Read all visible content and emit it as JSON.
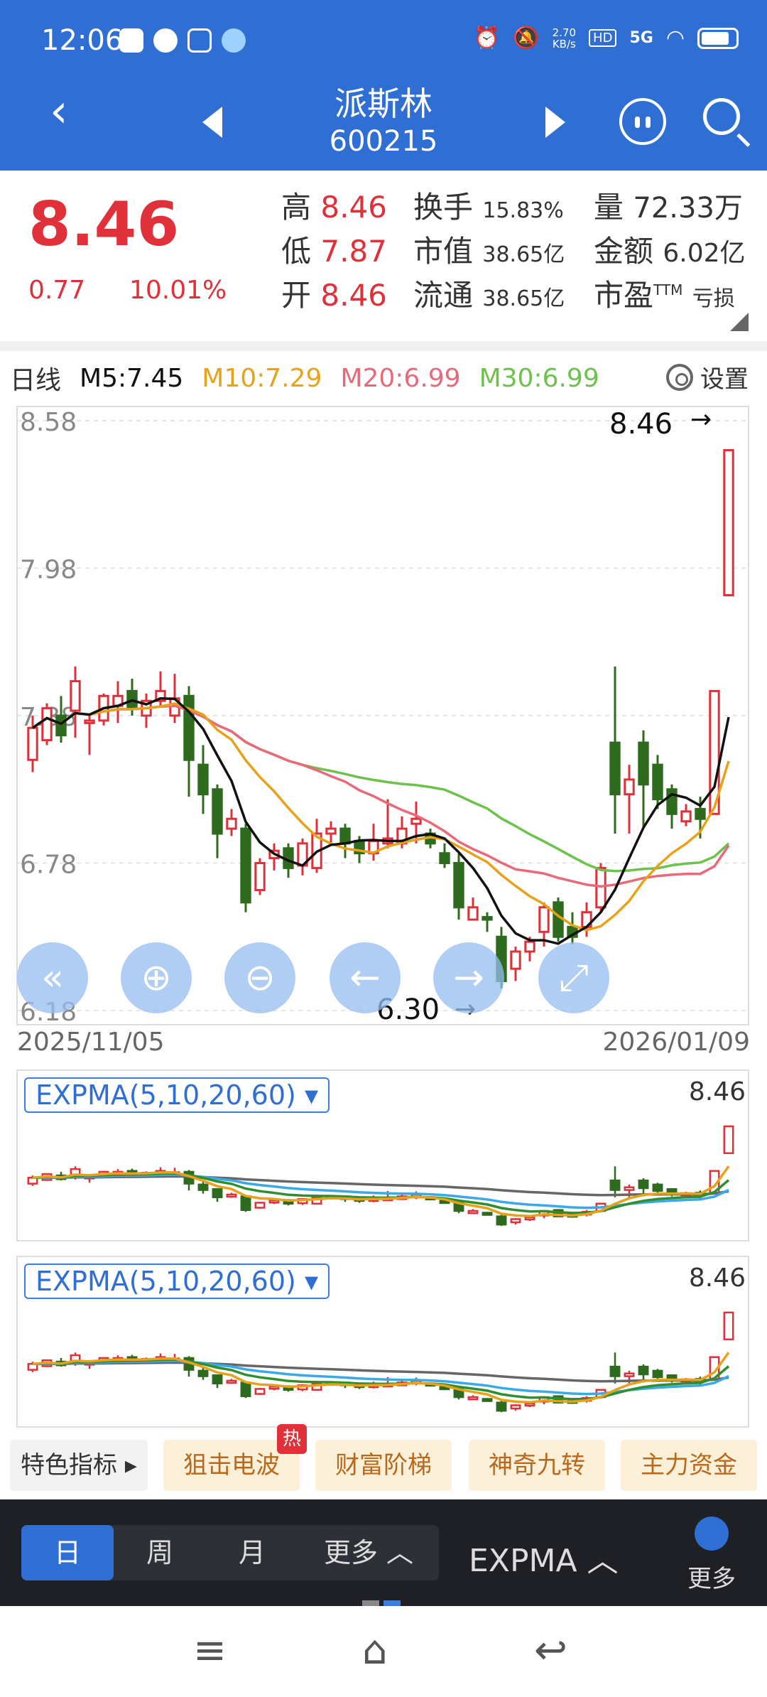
{
  "status": {
    "time": "12:06",
    "net_speed": "2.70\nKB/s",
    "hd": "HD",
    "signal": "5G"
  },
  "header": {
    "stock_name": "派斯林",
    "stock_code": "600215"
  },
  "quote": {
    "price": "8.46",
    "change": "0.77",
    "change_pct": "10.01%",
    "high_label": "高",
    "high": "8.46",
    "low_label": "低",
    "low": "7.87",
    "open_label": "开",
    "open": "8.46",
    "turnover_label": "换手",
    "turnover": "15.83%",
    "mktcap_label": "市值",
    "mktcap": "38.65亿",
    "float_label": "流通",
    "float": "38.65亿",
    "volume_label": "量",
    "volume": "72.33万",
    "amount_label": "金额",
    "amount": "6.02亿",
    "pe_label": "市盈",
    "pe_sup": "TTM",
    "pe": "亏损"
  },
  "ma_bar": {
    "period": "日线",
    "m5": "M5:7.45",
    "m10": "M10:7.29",
    "m20": "M20:6.99",
    "m30": "M30:6.99",
    "settings": "设置"
  },
  "colors": {
    "up": "#e0313a",
    "down": "#2f6b1f",
    "m5": "#111111",
    "m10": "#e8a21a",
    "m20": "#e86a7a",
    "m30": "#6cc24a",
    "accent": "#2f6ed3"
  },
  "main_chart": {
    "y_ticks": [
      "8.58",
      "7.98",
      "7.38",
      "6.78",
      "6.18"
    ],
    "max_label": "8.46",
    "min_label": "6.30",
    "date_start": "2025/11/05",
    "date_end": "2026/01/09"
  },
  "controls": [
    "rewind-icon",
    "zoom-in-icon",
    "zoom-out-icon",
    "arrow-left-icon",
    "arrow-right-icon",
    "fullscreen-icon"
  ],
  "sub1": {
    "name": "EXPMA(5,10,20,60) ▾",
    "value": "8.46"
  },
  "sub2": {
    "name": "EXPMA(5,10,20,60) ▾",
    "value": "8.46"
  },
  "features": {
    "special": "特色指标 ▸",
    "snipe": "狙击电波",
    "hot": "热",
    "wealth": "财富阶梯",
    "nine": "神奇九转",
    "fund": "主力资金"
  },
  "periods": {
    "day": "日",
    "week": "周",
    "month": "月",
    "more": "更多 ︿"
  },
  "indicator_btn": "EXPMA ︿",
  "more_btn": "更多",
  "chart_data": {
    "type": "candlestick",
    "x_range": [
      "2025/11/05",
      "2026/01/09"
    ],
    "ylim": [
      6.18,
      8.58
    ],
    "candles": [
      [
        7.2,
        7.33,
        7.15,
        7.38
      ],
      [
        7.28,
        7.41,
        7.26,
        7.43
      ],
      [
        7.38,
        7.3,
        7.27,
        7.46
      ],
      [
        7.4,
        7.52,
        7.29,
        7.58
      ],
      [
        7.35,
        7.36,
        7.22,
        7.38
      ],
      [
        7.36,
        7.46,
        7.34,
        7.47
      ],
      [
        7.42,
        7.46,
        7.35,
        7.52
      ],
      [
        7.48,
        7.41,
        7.38,
        7.53
      ],
      [
        7.38,
        7.44,
        7.33,
        7.47
      ],
      [
        7.44,
        7.48,
        7.42,
        7.56
      ],
      [
        7.38,
        7.45,
        7.35,
        7.55
      ],
      [
        7.46,
        7.2,
        7.05,
        7.5
      ],
      [
        7.18,
        7.06,
        6.98,
        7.26
      ],
      [
        7.08,
        6.9,
        6.8,
        7.1
      ],
      [
        6.92,
        6.96,
        6.89,
        7.0
      ],
      [
        6.92,
        6.62,
        6.58,
        6.94
      ],
      [
        6.67,
        6.78,
        6.65,
        6.8
      ],
      [
        6.8,
        6.83,
        6.75,
        6.86
      ],
      [
        6.84,
        6.76,
        6.72,
        6.86
      ],
      [
        6.77,
        6.86,
        6.73,
        6.88
      ],
      [
        6.76,
        6.9,
        6.74,
        6.96
      ],
      [
        6.9,
        6.92,
        6.86,
        6.95
      ],
      [
        6.92,
        6.86,
        6.8,
        6.94
      ],
      [
        6.87,
        6.82,
        6.78,
        6.89
      ],
      [
        6.82,
        6.87,
        6.79,
        6.94
      ],
      [
        6.86,
        6.88,
        6.84,
        7.04
      ],
      [
        6.86,
        6.92,
        6.84,
        6.97
      ],
      [
        6.94,
        6.96,
        6.86,
        7.03
      ],
      [
        6.9,
        6.86,
        6.84,
        6.92
      ],
      [
        6.82,
        6.78,
        6.76,
        6.86
      ],
      [
        6.78,
        6.6,
        6.55,
        6.82
      ],
      [
        6.55,
        6.6,
        6.55,
        6.64
      ],
      [
        6.56,
        6.55,
        6.5,
        6.58
      ],
      [
        6.48,
        6.3,
        6.27,
        6.52
      ],
      [
        6.35,
        6.42,
        6.3,
        6.44
      ],
      [
        6.42,
        6.46,
        6.38,
        6.48
      ],
      [
        6.5,
        6.6,
        6.44,
        6.62
      ],
      [
        6.62,
        6.48,
        6.46,
        6.64
      ],
      [
        6.52,
        6.48,
        6.45,
        6.58
      ],
      [
        6.52,
        6.58,
        6.48,
        6.62
      ],
      [
        6.6,
        6.76,
        6.58,
        6.78
      ],
      [
        7.27,
        7.06,
        6.9,
        7.58
      ],
      [
        7.06,
        7.12,
        6.9,
        7.18
      ],
      [
        7.27,
        7.1,
        6.92,
        7.32
      ],
      [
        7.18,
        7.04,
        7.0,
        7.22
      ],
      [
        7.08,
        6.98,
        6.92,
        7.1
      ],
      [
        6.95,
        6.99,
        6.93,
        7.02
      ],
      [
        7.0,
        6.96,
        6.88,
        7.05
      ],
      [
        6.98,
        7.48,
        6.99,
        7.48
      ],
      [
        7.87,
        8.46,
        7.87,
        8.46
      ]
    ],
    "series": [
      {
        "name": "M5",
        "value": 7.45
      },
      {
        "name": "M10",
        "value": 7.29
      },
      {
        "name": "M20",
        "value": 6.99
      },
      {
        "name": "M30",
        "value": 6.99
      }
    ]
  }
}
